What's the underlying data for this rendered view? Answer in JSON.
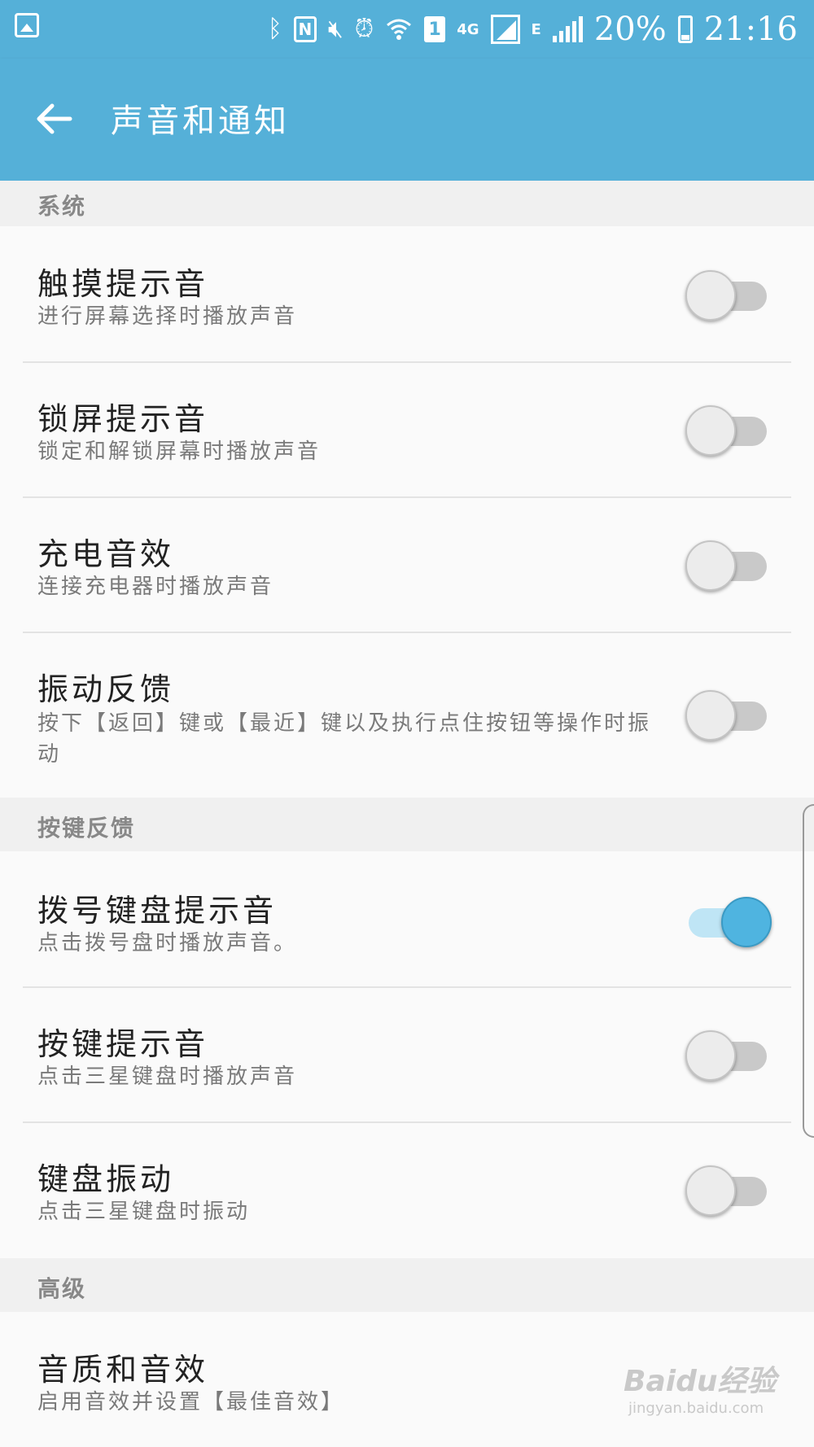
{
  "status_bar": {
    "battery_percent": "20%",
    "time": "21:16",
    "network": "4G",
    "network_secondary": "E",
    "sim_slot": "1",
    "icons": [
      "gallery-icon",
      "bluetooth-icon",
      "nfc-icon",
      "mute-icon",
      "alarm-icon",
      "wifi-icon",
      "sim-icon",
      "signal-icon",
      "battery-icon"
    ]
  },
  "app_bar": {
    "title": "声音和通知",
    "back_icon": "arrow-back-icon",
    "color": "#55b0d8"
  },
  "sections": [
    {
      "header": "系统",
      "items": [
        {
          "title": "触摸提示音",
          "subtitle": "进行屏幕选择时播放声音",
          "enabled": false
        },
        {
          "title": "锁屏提示音",
          "subtitle": "锁定和解锁屏幕时播放声音",
          "enabled": false
        },
        {
          "title": "充电音效",
          "subtitle": "连接充电器时播放声音",
          "enabled": false
        },
        {
          "title": "振动反馈",
          "subtitle": "按下【返回】键或【最近】键以及执行点住按钮等操作时振动",
          "enabled": false
        }
      ]
    },
    {
      "header": "按键反馈",
      "items": [
        {
          "title": "拨号键盘提示音",
          "subtitle": "点击拨号盘时播放声音。",
          "enabled": true
        },
        {
          "title": "按键提示音",
          "subtitle": "点击三星键盘时播放声音",
          "enabled": false
        },
        {
          "title": "键盘振动",
          "subtitle": "点击三星键盘时振动",
          "enabled": false
        }
      ]
    },
    {
      "header": "高级",
      "items": [
        {
          "title": "音质和音效",
          "subtitle": "启用音效并设置【最佳音效】"
        }
      ]
    }
  ],
  "watermark": {
    "brand": "Baidu经验",
    "url": "jingyan.baidu.com"
  },
  "colors": {
    "accent": "#4fb4e0",
    "section_bg": "#f0f0f0",
    "page_bg": "#fafafa"
  }
}
